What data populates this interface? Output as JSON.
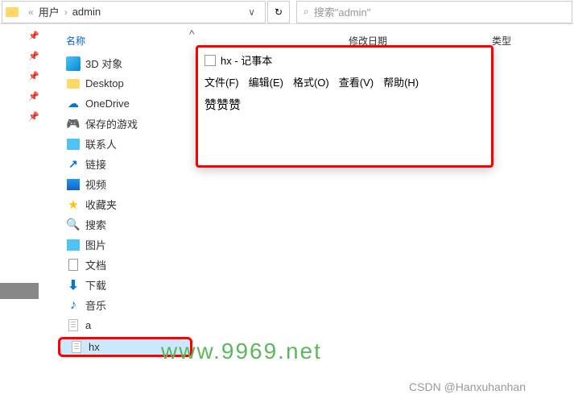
{
  "breadcrumb": {
    "double_chevron": "«",
    "parent": "用户",
    "chevron": "›",
    "current": "admin",
    "dropdown": "∨"
  },
  "refresh": "↻",
  "search": {
    "icon": "⌕",
    "placeholder": "搜索\"admin\""
  },
  "columns": {
    "name": "名称",
    "modified": "修改日期",
    "type": "类型"
  },
  "up_arrow": "^",
  "pins": [
    "📌",
    "📌",
    "📌",
    "📌",
    "📌"
  ],
  "files": [
    {
      "key": "3d",
      "label": "3D 对象"
    },
    {
      "key": "desktop",
      "label": "Desktop"
    },
    {
      "key": "onedrive",
      "label": "OneDrive"
    },
    {
      "key": "savedgames",
      "label": "保存的游戏"
    },
    {
      "key": "contacts",
      "label": "联系人"
    },
    {
      "key": "links",
      "label": "链接"
    },
    {
      "key": "videos",
      "label": "视频"
    },
    {
      "key": "favorites",
      "label": "收藏夹"
    },
    {
      "key": "searches",
      "label": "搜索"
    },
    {
      "key": "pictures",
      "label": "图片"
    },
    {
      "key": "documents",
      "label": "文档"
    },
    {
      "key": "downloads",
      "label": "下载"
    },
    {
      "key": "music",
      "label": "音乐"
    },
    {
      "key": "a",
      "label": "a"
    },
    {
      "key": "hx",
      "label": "hx"
    }
  ],
  "notepad": {
    "title": "hx - 记事本",
    "menu": {
      "file": "文件(F)",
      "edit": "编辑(E)",
      "format": "格式(O)",
      "view": "查看(V)",
      "help": "帮助(H)"
    },
    "content": "赞赞赞"
  },
  "watermark": "www.9969.net",
  "credit": "CSDN @Hanxuhanhan"
}
